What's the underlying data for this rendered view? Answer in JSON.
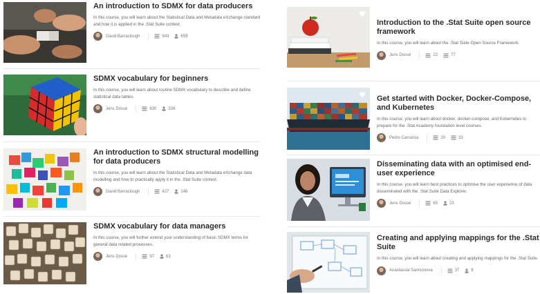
{
  "cards": [
    {
      "title": "An introduction to SDMX for data producers",
      "desc": "In this course, you will learn about the Statistical Data and Metadata eXchange standard and how it is applied in the .Stat Suite context.",
      "author": "David Barraclough",
      "lessons": "943",
      "learners": "659"
    },
    {
      "title": "SDMX vocabulary for beginners",
      "desc": "In this course, you will learn about routine SDMX vocabulary to describe and define statistical data tables.",
      "author": "Jens Dossé",
      "lessons": "630",
      "learners": "334"
    },
    {
      "title": "An introduction to SDMX structural modelling for data producers",
      "desc": "In this course, you will learn about the Statistical Data and Metadata eXchange data modelling and how to practically apply it in the .Stat Suite context.",
      "author": "David Barraclough",
      "lessons": "427",
      "learners": "148"
    },
    {
      "title": "SDMX vocabulary for data managers",
      "desc": "In this course, you will further extend your understanding of basic SDMX terms for general data related processes.",
      "author": "Jens Dossé",
      "lessons": "97",
      "learners": "63"
    },
    {
      "title": "Introduction to the .Stat Suite open source framework",
      "desc": "In this course, you will learn about the .Stat Suite Open Source Framework.",
      "author": "Jens Dossé",
      "lessons": "22",
      "learners": "77"
    },
    {
      "title": "Get started with Docker, Docker-Compose, and Kubernetes",
      "desc": "In this course, you will learn about docker, docker-compose, and Kubernetes to prepare for the .Stat Academy foundation level courses.",
      "author": "Pedro Carranza",
      "lessons": "20",
      "learners": "33"
    },
    {
      "title": "Disseminating data with an optimised end-user experience",
      "desc": "In this course, you will learn best practices to optimise the user experience of data disseminated with the .Stat Suite Data Explorer.",
      "author": "Jens Dossé",
      "lessons": "65",
      "learners": "23"
    },
    {
      "title": "Creating and applying mappings for the .Stat Suite",
      "desc": "In this course, you will learn about creating and applying mappings for the .Stat Suite.",
      "author": "Anastassia Samsonova",
      "lessons": "37",
      "learners": "8"
    }
  ]
}
